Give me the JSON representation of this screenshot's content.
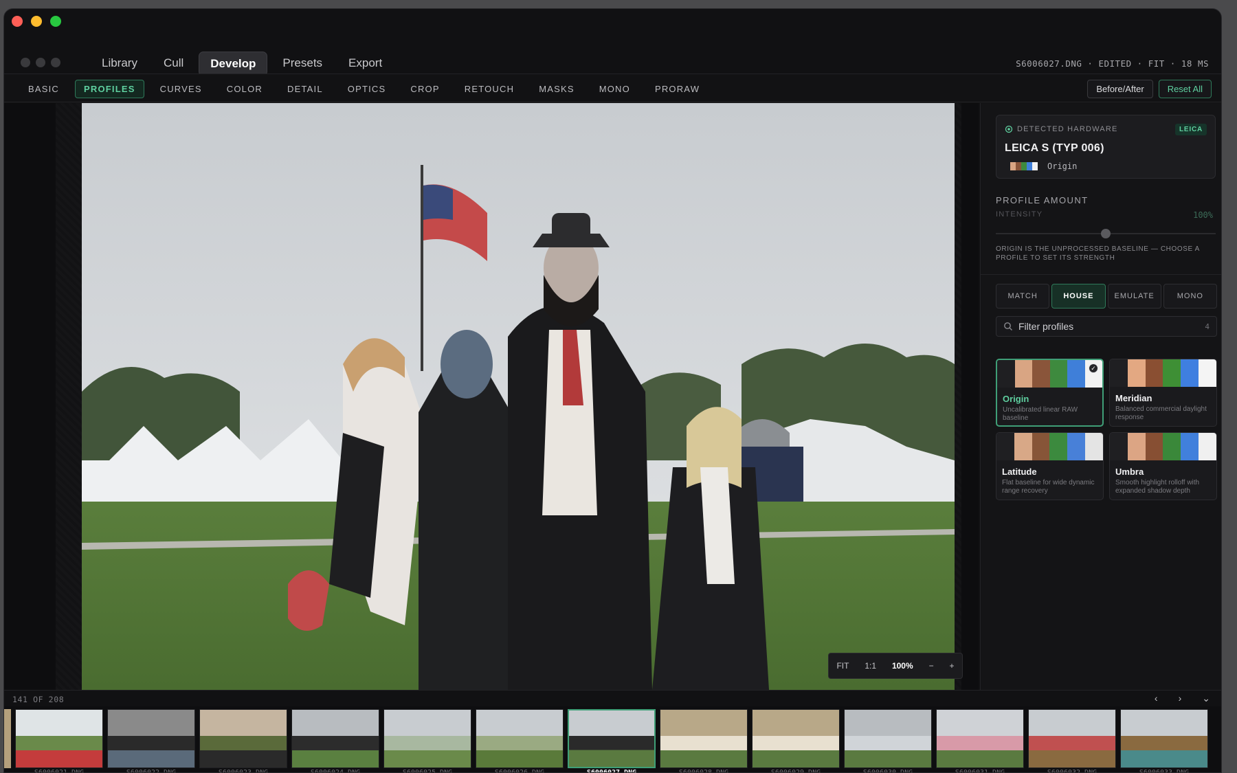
{
  "window": {
    "controls": [
      "close",
      "minimize",
      "zoom"
    ]
  },
  "nav": {
    "tabs": [
      {
        "label": "Library"
      },
      {
        "label": "Cull"
      },
      {
        "label": "Develop",
        "active": true
      },
      {
        "label": "Presets"
      },
      {
        "label": "Export"
      }
    ],
    "file_info": "S6006027.DNG · EDITED · FIT · 18 MS"
  },
  "subnav": {
    "tabs": [
      "BASIC",
      "PROFILES",
      "CURVES",
      "COLOR",
      "DETAIL",
      "OPTICS",
      "CROP",
      "RETOUCH",
      "MASKS",
      "MONO",
      "PRORAW"
    ],
    "active": "PROFILES",
    "before_after_label": "Before/After",
    "reset_label": "Reset All"
  },
  "zoom": {
    "fit": "FIT",
    "one_to_one": "1:1",
    "level": "100%",
    "minus": "−",
    "plus": "+"
  },
  "panel": {
    "hardware": {
      "label": "DETECTED HARDWARE",
      "badge": "LEICA",
      "name": "LEICA S (TYP 006)",
      "profile": "Origin"
    },
    "profile_amount": {
      "title": "PROFILE AMOUNT",
      "intensity_label": "INTENSITY",
      "value_label": "100%",
      "slider_fraction": 0.5,
      "note": "ORIGIN IS THE UNPROCESSED BASELINE — CHOOSE A PROFILE TO SET ITS STRENGTH"
    },
    "segments": [
      "MATCH",
      "HOUSE",
      "EMULATE",
      "MONO"
    ],
    "active_segment": "HOUSE",
    "filter": {
      "placeholder": "Filter profiles",
      "count": "4"
    },
    "profiles": [
      {
        "name": "Origin",
        "desc": "Uncalibrated linear RAW baseline",
        "selected": true,
        "swatch": [
          "#1f1f22",
          "#d9a583",
          "#8a553a",
          "#3e8a3e",
          "#3f7fd9",
          "#f2f2f2"
        ]
      },
      {
        "name": "Meridian",
        "desc": "Balanced commercial daylight response",
        "selected": false,
        "swatch": [
          "#1f1f22",
          "#e3a882",
          "#8a4f32",
          "#3e8f35",
          "#3f7fe0",
          "#f4f4f4"
        ]
      },
      {
        "name": "Latitude",
        "desc": "Flat baseline for wide dynamic range recovery",
        "selected": false,
        "swatch": [
          "#1f1f22",
          "#d8a887",
          "#875538",
          "#3c8a3e",
          "#4880d8",
          "#e4e4e4"
        ]
      },
      {
        "name": "Umbra",
        "desc": "Smooth highlight rolloff with expanded shadow depth",
        "selected": false,
        "swatch": [
          "#1f1f22",
          "#dca584",
          "#874f33",
          "#3a883a",
          "#4180dc",
          "#f0f0f0"
        ]
      }
    ]
  },
  "filmstrip": {
    "count_label": "141 OF 208",
    "prev": "‹",
    "next": "›",
    "collapse": "⌄",
    "thumbs": [
      {
        "label": "S6006021.DNG",
        "colors": [
          "#dfe4e6",
          "#6a8a4a",
          "#c43c3c"
        ]
      },
      {
        "label": "S6006022.DNG",
        "colors": [
          "#8a8a8a",
          "#2a2a2a",
          "#5a6a7a"
        ]
      },
      {
        "label": "S6006023.DNG",
        "colors": [
          "#c5b5a0",
          "#5a6a3a",
          "#2a2a2a"
        ]
      },
      {
        "label": "S6006024.DNG",
        "colors": [
          "#b8bcc0",
          "#2c2c2c",
          "#5a8040"
        ]
      },
      {
        "label": "S6006025.DNG",
        "colors": [
          "#c8ccd0",
          "#a8b8a0",
          "#6a8a4a"
        ]
      },
      {
        "label": "S6006026.DNG",
        "colors": [
          "#c8ccd0",
          "#9aaa82",
          "#5a7a3a"
        ]
      },
      {
        "label": "S6006027.DNG",
        "colors": [
          "#c8ccd0",
          "#2a2a2a",
          "#5a7a40"
        ],
        "active": true
      },
      {
        "label": "S6006028.DNG",
        "colors": [
          "#b8a888",
          "#e8e0d0",
          "#5a7a40"
        ]
      },
      {
        "label": "S6006029.DNG",
        "colors": [
          "#b8a888",
          "#e8e0d0",
          "#5a7a40"
        ]
      },
      {
        "label": "S6006030.DNG",
        "colors": [
          "#b8bcc0",
          "#d0d4d8",
          "#5a7a40"
        ]
      },
      {
        "label": "S6006031.DNG",
        "colors": [
          "#cfd2d6",
          "#d89aa8",
          "#5a7a40"
        ]
      },
      {
        "label": "S6006032.DNG",
        "colors": [
          "#c8ccd0",
          "#c05050",
          "#8a6a40"
        ]
      },
      {
        "label": "S6006033.DNG",
        "colors": [
          "#c8ccd0",
          "#8a6a40",
          "#4a8a8a"
        ]
      }
    ]
  },
  "colors": {
    "accent": "#5fd0a0",
    "accent_border": "#3f9f77",
    "bg": "#111113"
  }
}
